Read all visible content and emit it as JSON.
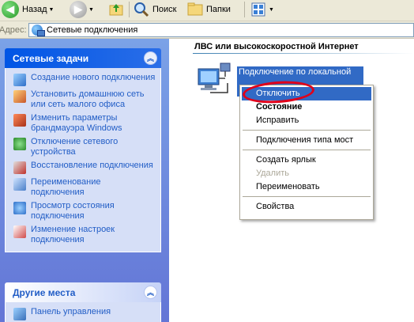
{
  "toolbar": {
    "back_label": "Назад",
    "search_label": "Поиск",
    "folders_label": "Папки",
    "icons": [
      "back-arrow-icon",
      "forward-arrow-icon",
      "up-folder-icon",
      "search-icon",
      "folders-icon",
      "views-icon"
    ]
  },
  "address": {
    "label": "Адрес:",
    "value": "Сетевые подключения"
  },
  "tasks_panel": {
    "title": "Сетевые задачи",
    "items": [
      {
        "label": "Создание нового подключения",
        "icon": "new-connection-icon"
      },
      {
        "label": "Установить домашнюю сеть или сеть малого офиса",
        "icon": "home-network-icon"
      },
      {
        "label": "Изменить параметры брандмауэра Windows",
        "icon": "firewall-icon"
      },
      {
        "label": "Отключение сетевого устройства",
        "icon": "disable-device-icon"
      },
      {
        "label": "Восстановление подключения",
        "icon": "repair-icon"
      },
      {
        "label": "Переименование подключения",
        "icon": "rename-icon"
      },
      {
        "label": "Просмотр состояния подключения",
        "icon": "status-icon"
      },
      {
        "label": "Изменение настроек подключения",
        "icon": "settings-icon"
      }
    ]
  },
  "other_places": {
    "title": "Другие места",
    "items": [
      {
        "label": "Панель управления",
        "icon": "control-panel-icon"
      }
    ]
  },
  "main": {
    "section_title": "ЛВС или высокоскоростной Интернет",
    "connection_label": "Подключение по локальной"
  },
  "context_menu": {
    "items": [
      {
        "label": "Отключить",
        "state": "selected"
      },
      {
        "label": "Состояние",
        "state": "bold"
      },
      {
        "label": "Исправить",
        "state": "normal"
      },
      {
        "label": "Подключения типа мост",
        "state": "normal"
      },
      {
        "label": "Создать ярлык",
        "state": "normal"
      },
      {
        "label": "Удалить",
        "state": "disabled"
      },
      {
        "label": "Переименовать",
        "state": "normal"
      },
      {
        "label": "Свойства",
        "state": "normal"
      }
    ]
  },
  "colors": {
    "selection": "#316ac5",
    "annotation": "#e0001a",
    "pane_gradient_top": "#7ba2e7",
    "link": "#215dc6"
  }
}
